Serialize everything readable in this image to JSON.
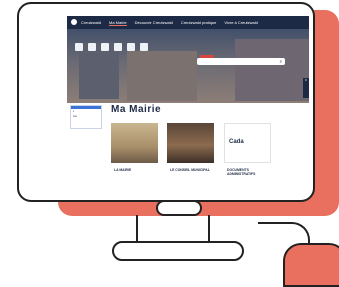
{
  "nav": {
    "items": [
      "Creutzwald",
      "Ma Mairie",
      "Découvrir Creutzwald",
      "Creutzwald pratique",
      "Vivre à Creutzwald"
    ]
  },
  "hero": {
    "search_placeholder": "Rechercher"
  },
  "page": {
    "title": "Ma Mairie"
  },
  "cards": [
    {
      "label": "LA MAIRIE"
    },
    {
      "label": "LE CONSEIL MUNICIPAL"
    },
    {
      "label": "DOCUMENTS ADMINISTRATIFS"
    }
  ],
  "colors": {
    "navy": "#1d2a45",
    "accent": "#e9705f"
  }
}
